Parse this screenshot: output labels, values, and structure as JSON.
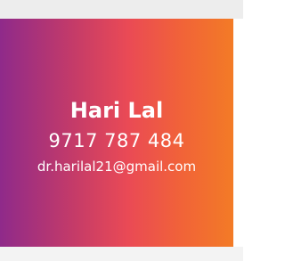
{
  "contact": {
    "name": "Hari Lal",
    "phone": "9717 787 484",
    "email": "dr.harilal21@gmail.com"
  },
  "theme": {
    "gradient_start": "#8f2a8a",
    "gradient_mid": "#ea4a55",
    "gradient_end": "#f37b26",
    "text_color": "#ffffff"
  }
}
